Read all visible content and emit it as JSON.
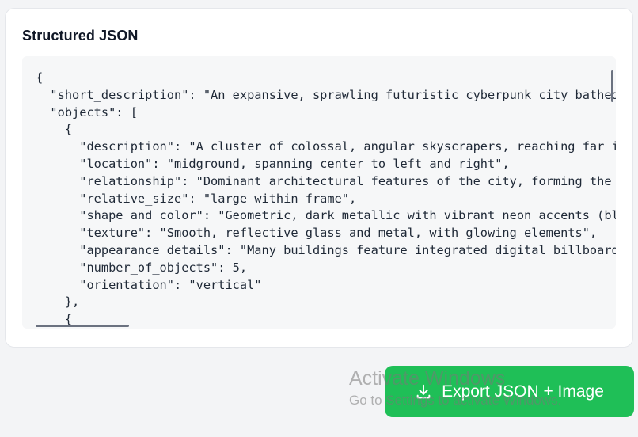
{
  "panel": {
    "title": "Structured JSON"
  },
  "code": {
    "lines": [
      "{",
      "  \"short_description\": \"An expansive, sprawling futuristic cyberpunk city bathed i",
      "  \"objects\": [",
      "    {",
      "      \"description\": \"A cluster of colossal, angular skyscrapers, reaching far int",
      "      \"location\": \"midground, spanning center to left and right\",",
      "      \"relationship\": \"Dominant architectural features of the city, forming the pr",
      "      \"relative_size\": \"large within frame\",",
      "      \"shape_and_color\": \"Geometric, dark metallic with vibrant neon accents (blue",
      "      \"texture\": \"Smooth, reflective glass and metal, with glowing elements\",",
      "      \"appearance_details\": \"Many buildings feature integrated digital billboards",
      "      \"number_of_objects\": 5,",
      "      \"orientation\": \"vertical\"",
      "    },",
      "    {"
    ]
  },
  "actions": {
    "export_label": "Export JSON + Image"
  },
  "watermark": {
    "title": "Activate Windows",
    "subtitle": "Go to Settings to activate Windows."
  },
  "colors": {
    "export_button": "#1fbf57",
    "code_background": "#f6f7f8",
    "panel_background": "#ffffff",
    "page_background": "#f3f4f6"
  },
  "icons": {
    "export": "download-icon"
  }
}
